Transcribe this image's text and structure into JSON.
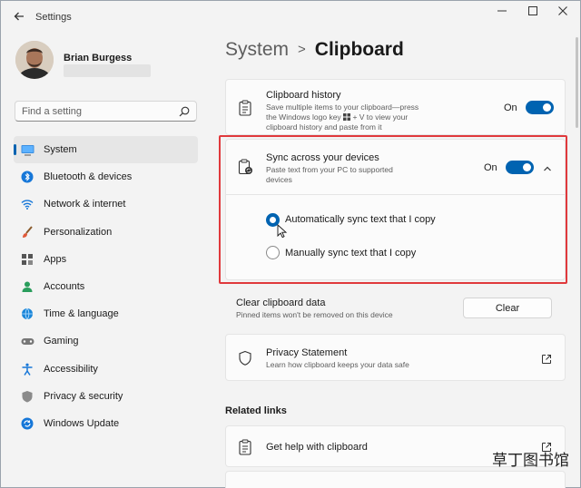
{
  "window": {
    "title": "Settings"
  },
  "user": {
    "name": "Brian Burgess"
  },
  "search": {
    "placeholder": "Find a setting"
  },
  "sidebar": {
    "items": [
      {
        "label": "System",
        "icon": "system-icon",
        "active": true
      },
      {
        "label": "Bluetooth & devices",
        "icon": "bluetooth-icon"
      },
      {
        "label": "Network & internet",
        "icon": "wifi-icon"
      },
      {
        "label": "Personalization",
        "icon": "brush-icon"
      },
      {
        "label": "Apps",
        "icon": "apps-icon"
      },
      {
        "label": "Accounts",
        "icon": "person-icon"
      },
      {
        "label": "Time & language",
        "icon": "globe-clock-icon"
      },
      {
        "label": "Gaming",
        "icon": "gamepad-icon"
      },
      {
        "label": "Accessibility",
        "icon": "accessibility-icon"
      },
      {
        "label": "Privacy & security",
        "icon": "shield-icon"
      },
      {
        "label": "Windows Update",
        "icon": "update-icon"
      }
    ]
  },
  "breadcrumb": {
    "parent": "System",
    "separator": ">",
    "current": "Clipboard"
  },
  "history": {
    "title": "Clipboard history",
    "desc": [
      "Save multiple items to your clipboard—press",
      "the Windows logo key",
      "+ V to view your",
      "clipboard history and paste from it"
    ],
    "state": "On"
  },
  "sync": {
    "title": "Sync across your devices",
    "desc": [
      "Paste text from your PC to supported",
      "devices"
    ],
    "state": "On",
    "options": [
      {
        "label": "Automatically sync text that I copy",
        "checked": true
      },
      {
        "label": "Manually sync text that I copy",
        "checked": false
      }
    ]
  },
  "clear": {
    "title": "Clear clipboard data",
    "desc": "Pinned items won't be removed on this device",
    "button": "Clear"
  },
  "privacy": {
    "title": "Privacy Statement",
    "desc": "Learn how clipboard keeps your data safe"
  },
  "related": {
    "title": "Related links",
    "help": "Get help with clipboard"
  },
  "watermark": {
    "text": "草丁图书馆"
  },
  "colors": {
    "accent": "#0063b1",
    "highlight": "#e0393c"
  }
}
